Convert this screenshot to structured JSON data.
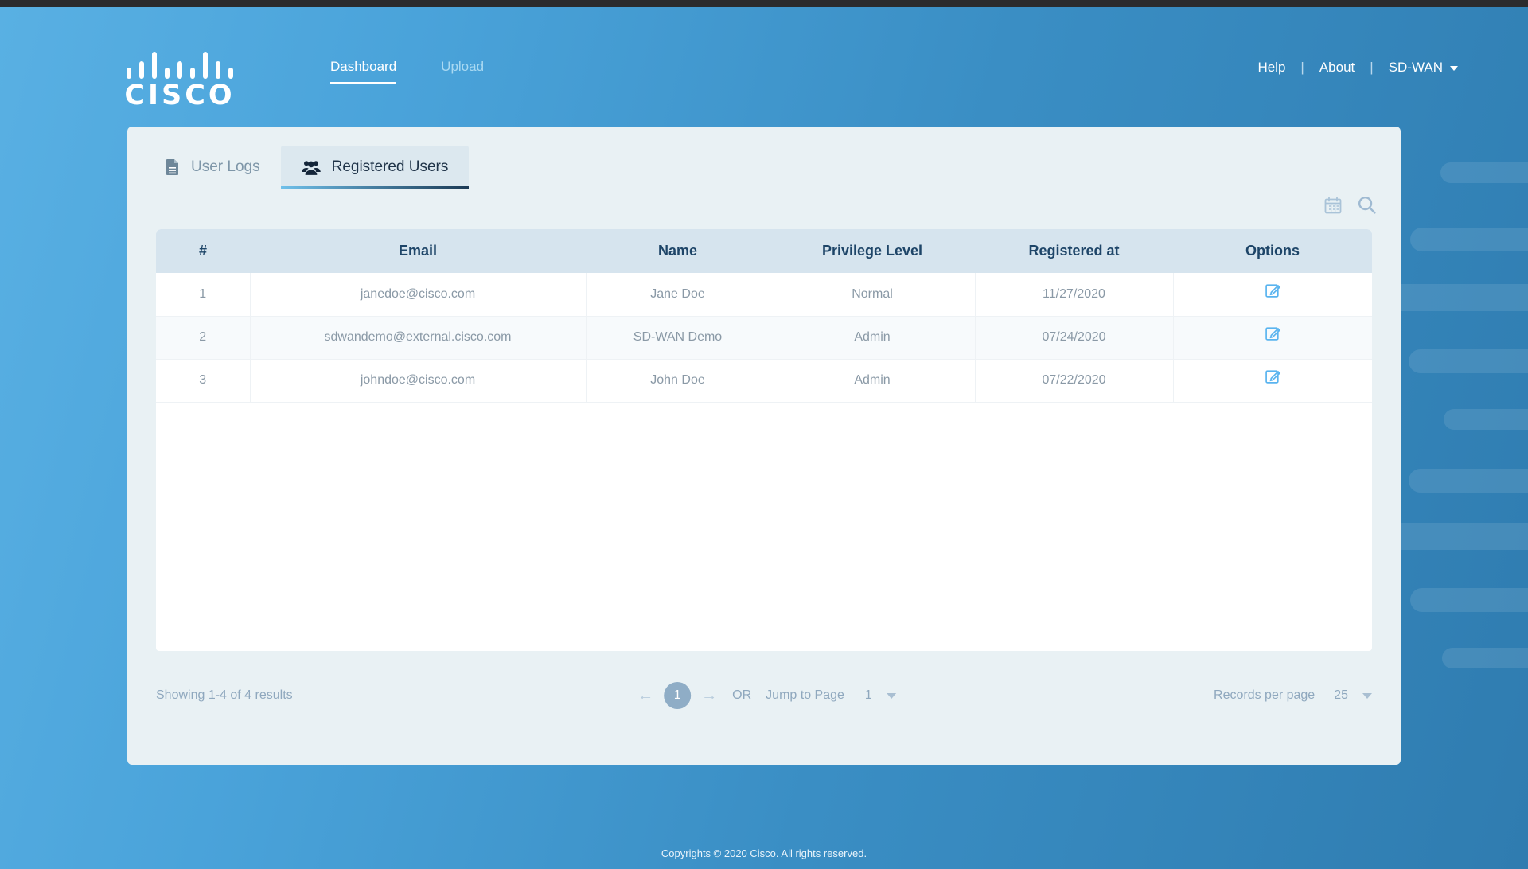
{
  "brand": {
    "logo_text": "CISCO",
    "logo_icon": "cisco-bars-logo"
  },
  "header": {
    "nav": [
      {
        "label": "Dashboard",
        "active": true
      },
      {
        "label": "Upload",
        "active": false
      }
    ],
    "right": {
      "help": "Help",
      "about": "About",
      "separator": "|",
      "user": "SD-WAN",
      "caret_icon": "chevron-down-icon"
    }
  },
  "tabs": [
    {
      "label": "User Logs",
      "icon": "document-icon",
      "active": false
    },
    {
      "label": "Registered Users",
      "icon": "users-icon",
      "active": true
    }
  ],
  "toolbar": {
    "calendar_icon": "calendar-icon",
    "search_icon": "search-icon"
  },
  "table": {
    "columns": [
      "#",
      "Email",
      "Name",
      "Privilege Level",
      "Registered at",
      "Options"
    ],
    "rows": [
      {
        "index": "1",
        "email": "janedoe@cisco.com",
        "name": "Jane Doe",
        "privilege": "Normal",
        "registered_at": "11/27/2020",
        "action_icon": "edit-icon"
      },
      {
        "index": "2",
        "email": "sdwandemo@external.cisco.com",
        "name": "SD-WAN Demo",
        "privilege": "Admin",
        "registered_at": "07/24/2020",
        "action_icon": "edit-icon"
      },
      {
        "index": "3",
        "email": "johndoe@cisco.com",
        "name": "John Doe",
        "privilege": "Admin",
        "registered_at": "07/22/2020",
        "action_icon": "edit-icon"
      }
    ]
  },
  "pagination": {
    "showing": "Showing 1-4 of 4 results",
    "prev_icon": "arrow-left-icon",
    "next_icon": "arrow-right-icon",
    "current_page": "1",
    "or_label": "OR",
    "jump_label": "Jump to Page",
    "jump_value": "1",
    "records_label": "Records per page",
    "records_value": "25",
    "dropdown_icon": "caret-down-icon"
  },
  "footer": {
    "copyright": "Copyrights © 2020 Cisco. All rights reserved."
  },
  "colors": {
    "brand_blue": "#4aa3da",
    "card_bg": "#e9f1f4",
    "table_header_bg": "#d6e4ee",
    "header_text": "#1e4568",
    "accent_edit": "#5ab4ef",
    "page_pill": "#8fadc6"
  }
}
